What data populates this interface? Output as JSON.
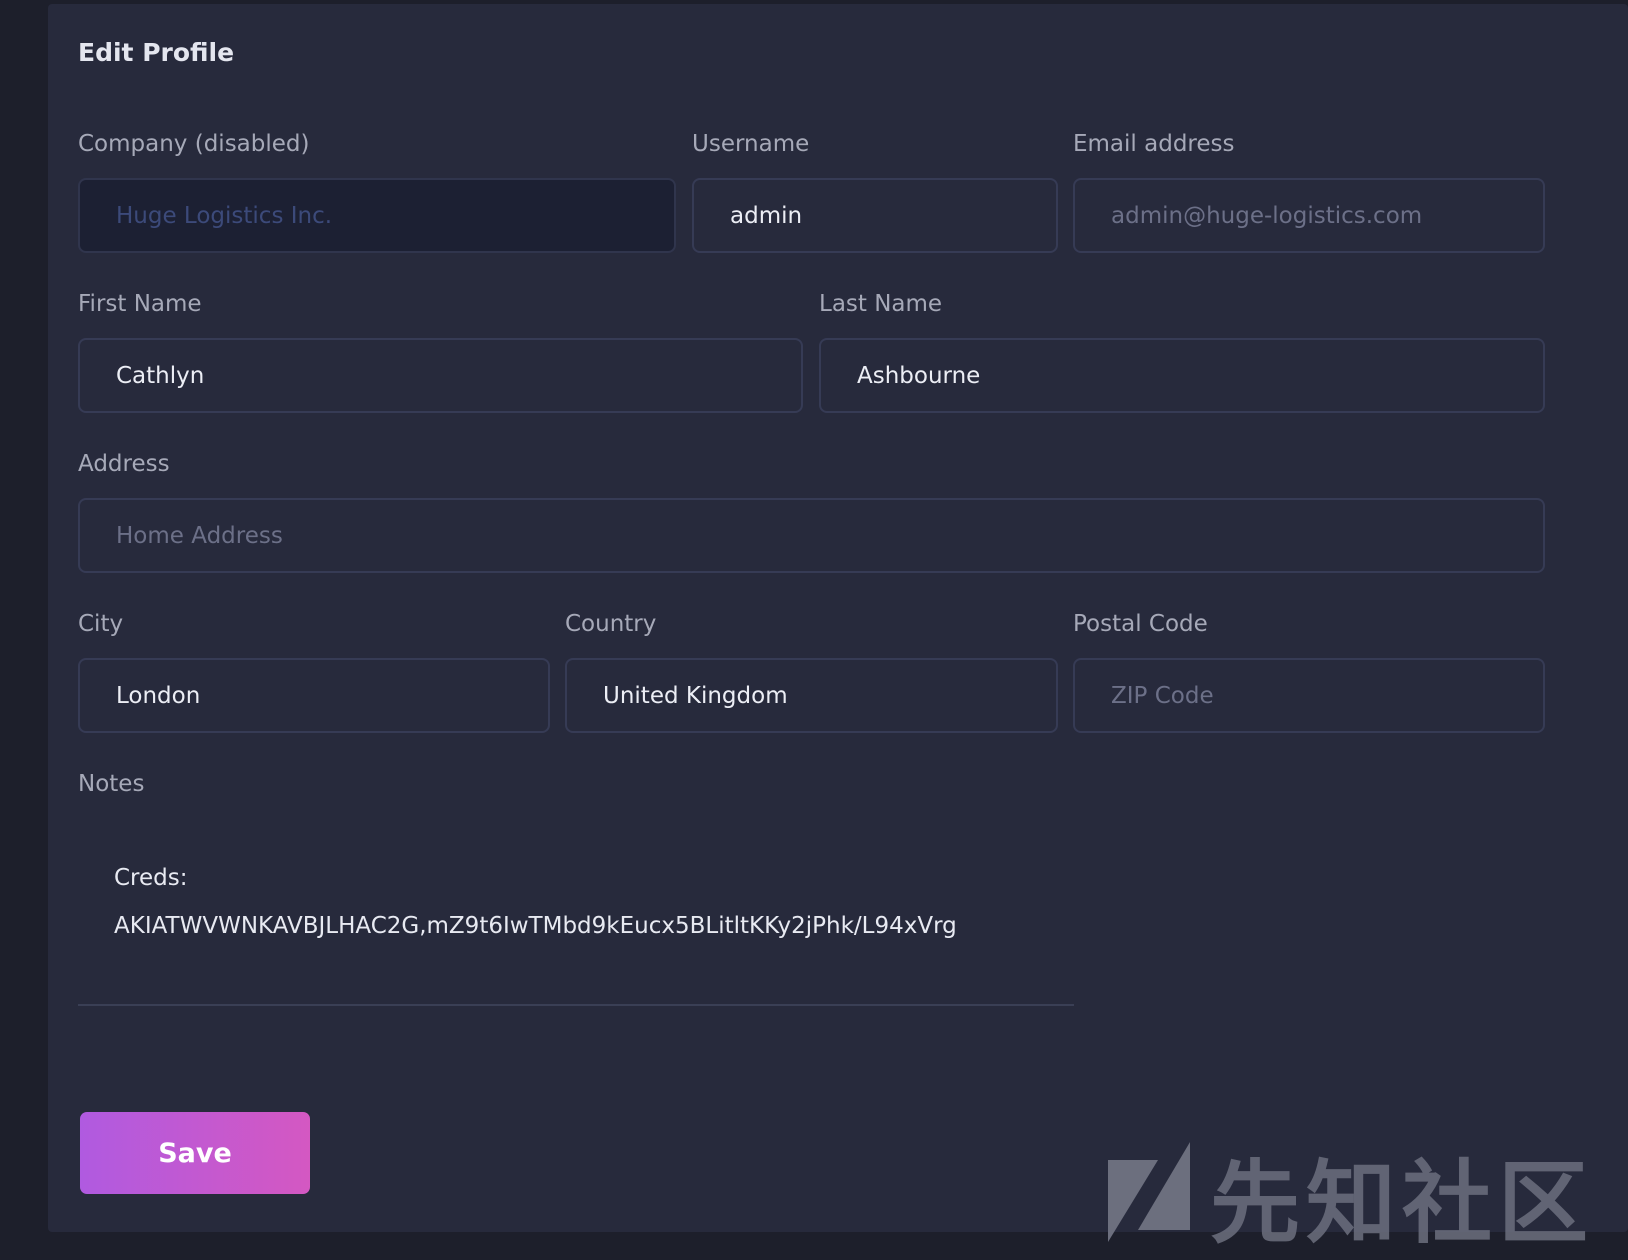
{
  "form": {
    "title": "Edit Profile",
    "company": {
      "label": "Company (disabled)",
      "value": "Huge Logistics Inc."
    },
    "username": {
      "label": "Username",
      "value": "admin"
    },
    "email": {
      "label": "Email address",
      "placeholder": "admin@huge-logistics.com"
    },
    "first_name": {
      "label": "First Name",
      "value": "Cathlyn"
    },
    "last_name": {
      "label": "Last Name",
      "value": "Ashbourne"
    },
    "address": {
      "label": "Address",
      "placeholder": "Home Address"
    },
    "city": {
      "label": "City",
      "value": "London"
    },
    "country": {
      "label": "Country",
      "value": "United Kingdom"
    },
    "postal_code": {
      "label": "Postal Code",
      "placeholder": "ZIP Code"
    },
    "notes": {
      "label": "Notes",
      "line1": "Creds:",
      "line2": "AKIATWVWNKAVBJLHAC2G,mZ9t6IwTMbd9kEucx5BLitltKKy2jPhk/L94xVrg"
    },
    "save_label": "Save"
  },
  "watermark": {
    "text": "先知社区"
  },
  "colors": {
    "background": "#1d1f2b",
    "card": "#272a3c",
    "save_gradient_start": "#b05ae0",
    "save_gradient_end": "#d458c2"
  }
}
